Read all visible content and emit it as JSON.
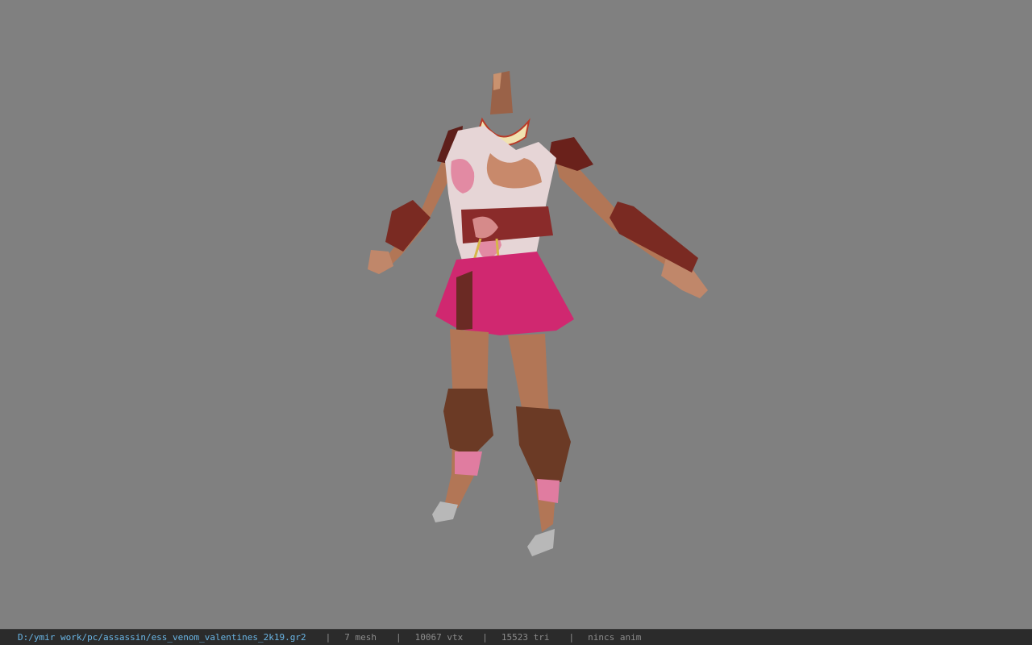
{
  "viewer": {
    "background_color": "#808080",
    "model_label": "character-model"
  },
  "status": {
    "file_path": "D:/ymir work/pc/assassin/ess_venom_valentines_2k19.gr2",
    "separator": "|",
    "mesh": "7 mesh",
    "vtx": "10067 vtx",
    "tri": "15523 tri",
    "anim": "nincs anim"
  },
  "colors": {
    "skin": "#b07a5a",
    "skirt": "#d02870",
    "top": "#e8d8d8",
    "armor": "#7a2a22",
    "guard": "#6b3a25",
    "metal": "#b8b8b8",
    "path_text": "#6ab6e6"
  }
}
